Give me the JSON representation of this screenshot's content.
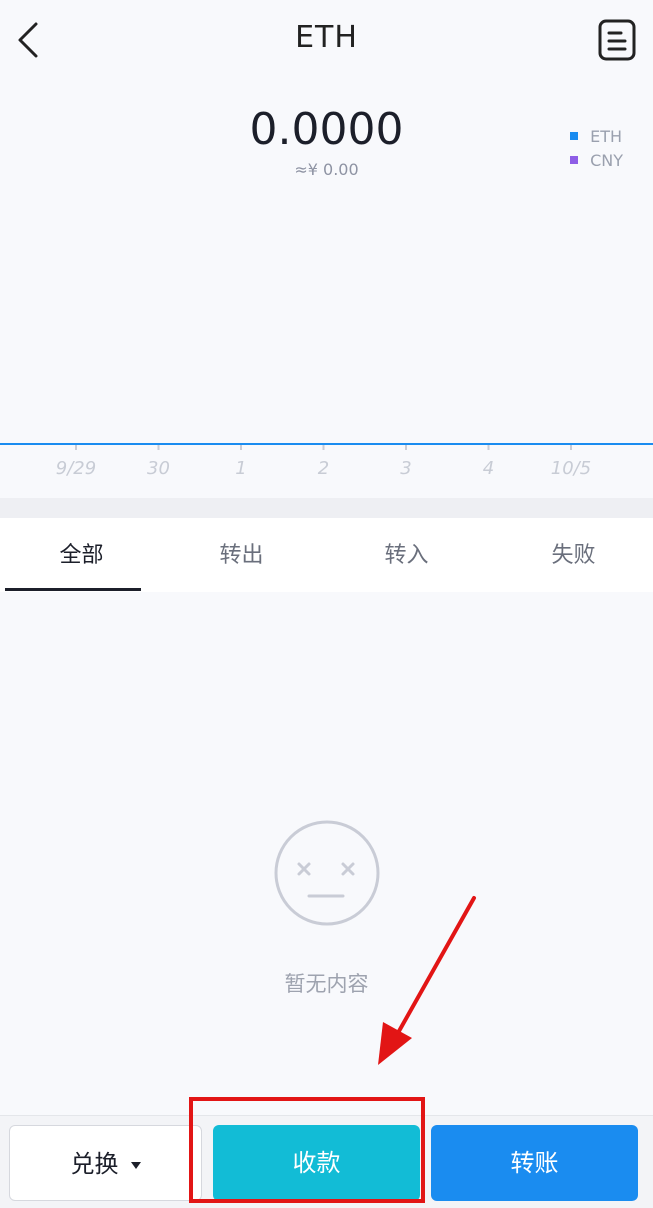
{
  "header": {
    "title": "ETH",
    "back_icon": "back-chevron-icon",
    "record_icon": "document-list-icon"
  },
  "balance": {
    "amount": "0.0000",
    "fiat": "≈¥ 0.00"
  },
  "legend": [
    {
      "label": "ETH",
      "color": "#1a8cf0"
    },
    {
      "label": "CNY",
      "color": "#8e5ee6"
    }
  ],
  "chart_data": {
    "type": "line",
    "categories": [
      "9/29",
      "30",
      "1",
      "2",
      "3",
      "4",
      "10/5"
    ],
    "series": [
      {
        "name": "ETH",
        "values": [
          0,
          0,
          0,
          0,
          0,
          0,
          0
        ]
      }
    ]
  },
  "tabs": [
    {
      "label": "全部",
      "active": true
    },
    {
      "label": "转出",
      "active": false
    },
    {
      "label": "转入",
      "active": false
    },
    {
      "label": "失败",
      "active": false
    }
  ],
  "empty_state": {
    "text": "暂无内容",
    "icon": "neutral-face-icon"
  },
  "actions": {
    "exchange": "兑换",
    "receive": "收款",
    "transfer": "转账"
  },
  "annotation": {
    "color": "#e21515",
    "highlight_target": "receive-button"
  }
}
